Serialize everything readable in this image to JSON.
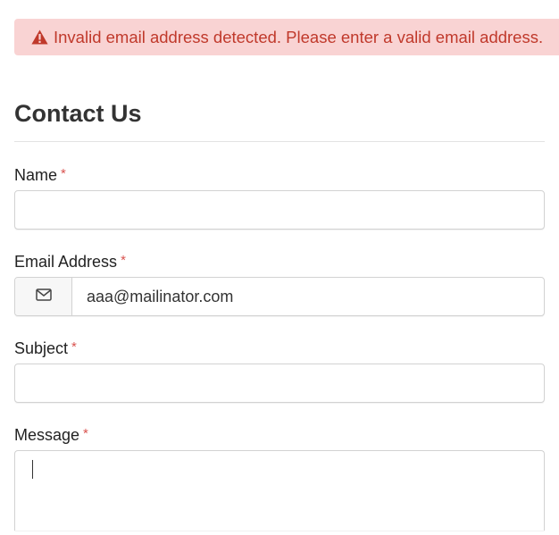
{
  "alert": {
    "icon": "warning-triangle-icon",
    "message": "Invalid email address detected. Please enter a valid email address.",
    "background": "#f9d3d3",
    "text_color": "#c0392b"
  },
  "form": {
    "title": "Contact Us",
    "required_marker": "*",
    "name": {
      "label": "Name",
      "value": ""
    },
    "email": {
      "label": "Email Address",
      "icon": "envelope-icon",
      "value": "aaa@mailinator.com"
    },
    "subject": {
      "label": "Subject",
      "value": ""
    },
    "message": {
      "label": "Message",
      "value": ""
    }
  }
}
